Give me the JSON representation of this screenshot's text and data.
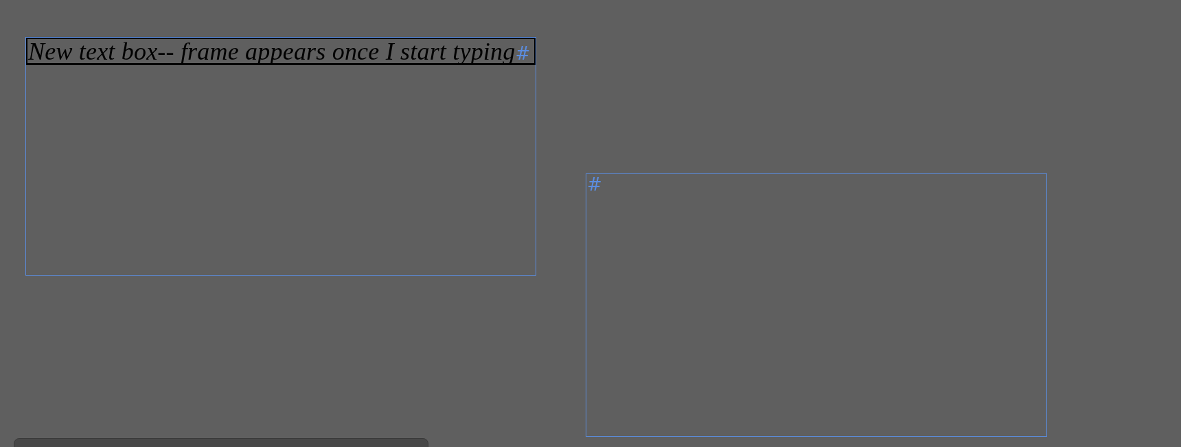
{
  "frames": [
    {
      "text": "New text box-- frame appears once I start typing",
      "end_marker": "#",
      "selected": true
    },
    {
      "end_marker": "#",
      "selected": false
    }
  ]
}
